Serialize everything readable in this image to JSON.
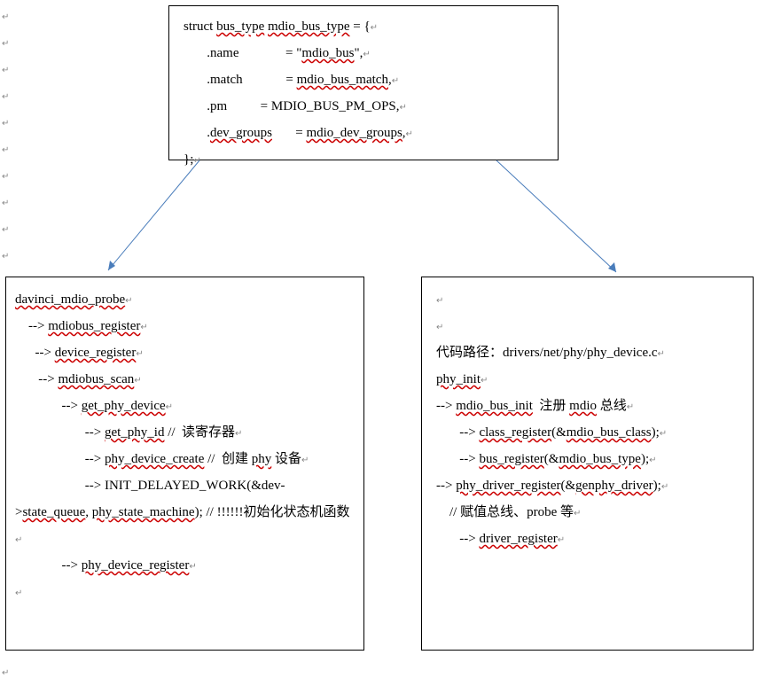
{
  "top": {
    "l1_a": "struct ",
    "l1_b": "bus_type",
    "l1_c": " ",
    "l1_d": "mdio_bus_type",
    "l1_e": " = {",
    "l2_a": "       .name              = \"",
    "l2_b": "mdio_bus",
    "l2_c": "\",",
    "l3_a": "       .match             = ",
    "l3_b": "mdio_bus_match",
    "l3_c": ",",
    "l4_a": "       .pm          = MDIO_BUS_PM_OPS,",
    "l5_a": "       .",
    "l5_b": "dev_groups",
    "l5_c": "       = ",
    "l5_d": "mdio_dev_groups",
    "l5_e": ",",
    "l6": "};"
  },
  "left": {
    "l1": "davinci_mdio_probe",
    "l2_a": "    --> ",
    "l2_b": "mdiobus_register",
    "l3_a": "      --> ",
    "l3_b": "device_register",
    "l4_a": "       --> ",
    "l4_b": "mdiobus_scan",
    "l5_a": "              --> ",
    "l5_b": "get_phy_device",
    "l6_a": "                     --> ",
    "l6_b": "get_phy_id",
    "l6_c": " //  读寄存器",
    "l7_a": "                     --> ",
    "l8_a": "phy_device_create",
    "l8_b": " //  创建 ",
    "l8_c": "phy",
    "l8_d": " 设备",
    "l9_a": "                     --> INIT_DELAYED_WORK(&dev->",
    "l9_b": "state_queue",
    "l9_c": ", ",
    "l9_d": "phy_state_machine",
    "l9_e": "); // !!!!!!初始化状态机函数",
    "l10_a": "              --> ",
    "l10_b": "phy_device_register"
  },
  "right": {
    "l1": "代码路径：drivers/net/phy/phy_device.c",
    "l2": "phy_init",
    "l3_a": "--> ",
    "l3_b": "mdio_bus_init",
    "l3_c": "  注册 ",
    "l3_d": "mdio",
    "l3_e": " 总线",
    "l4_a": "       --> ",
    "l4_b": "class_register",
    "l4_c": "(&",
    "l4_d": "mdio_bus_class",
    "l4_e": ");",
    "l5_a": "       --> ",
    "l5_b": "bus_register",
    "l5_c": "(&",
    "l5_d": "mdio_bus_type",
    "l5_e": ");",
    "l6_a": "--> ",
    "l6_b": "phy_driver_register",
    "l6_c": "(&",
    "l6_d": "genphy_driver",
    "l6_e": ");",
    "l7": "    // 赋值总线、probe 等",
    "l8_a": "       --> ",
    "l8_b": "driver_register"
  }
}
